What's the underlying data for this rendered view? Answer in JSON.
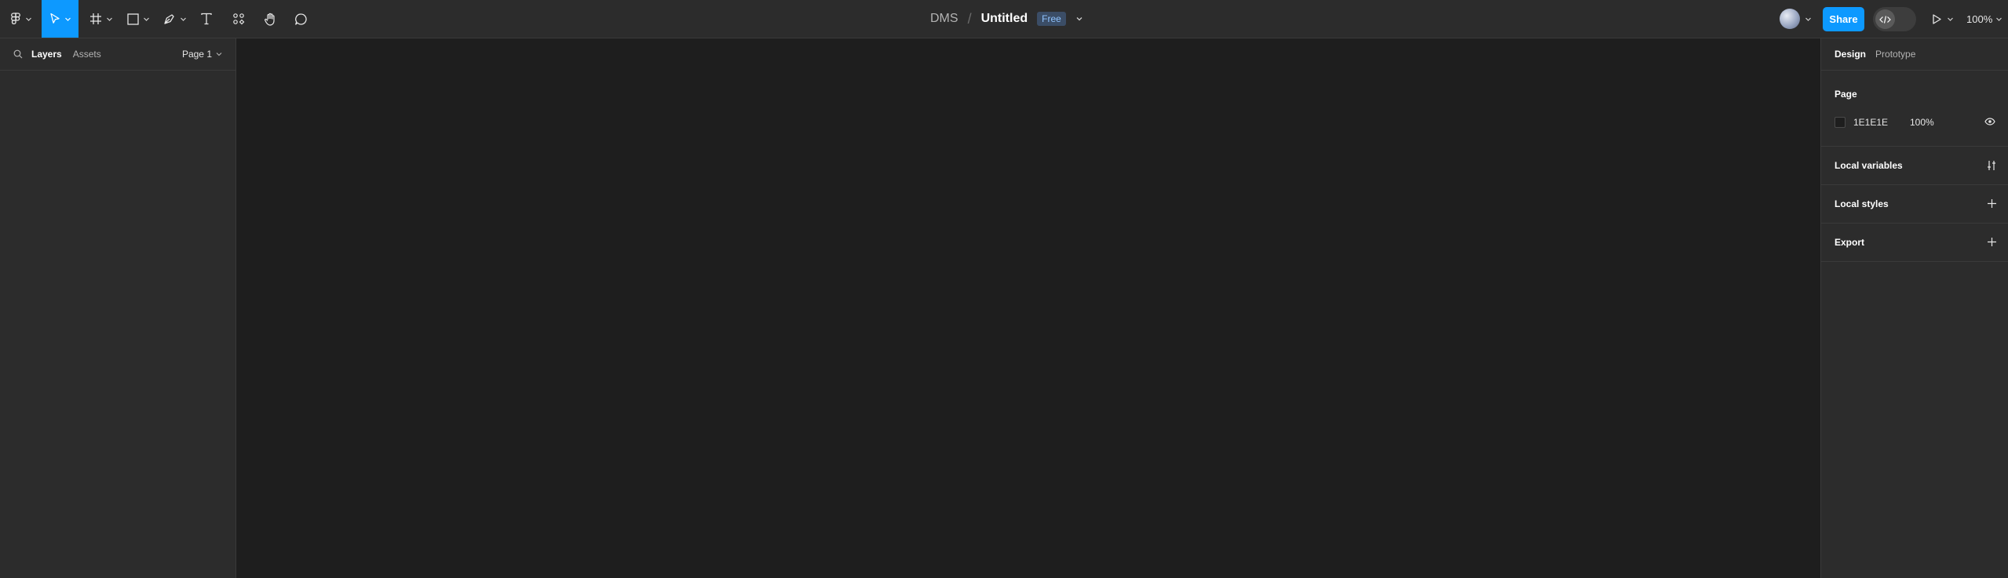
{
  "toolbar": {
    "tools": [
      "main-menu",
      "move",
      "frame",
      "shape",
      "pen",
      "text",
      "resources",
      "hand",
      "comment"
    ],
    "active_tool": "move",
    "project": "DMS",
    "separator": "/",
    "filename": "Untitled",
    "plan_badge": "Free",
    "share_label": "Share",
    "zoom": "100%"
  },
  "left_panel": {
    "tabs": [
      "Layers",
      "Assets"
    ],
    "active_tab": "Layers",
    "page_selector": "Page 1"
  },
  "right_panel": {
    "tabs": [
      "Design",
      "Prototype"
    ],
    "active_tab": "Design",
    "page_section": {
      "title": "Page",
      "background_hex": "1E1E1E",
      "opacity": "100%"
    },
    "local_variables": "Local variables",
    "local_styles": "Local styles",
    "export": "Export"
  },
  "colors": {
    "accent": "#0d99ff",
    "panel": "#2c2c2c",
    "canvas": "#1e1e1e",
    "page_background": "#1E1E1E"
  }
}
